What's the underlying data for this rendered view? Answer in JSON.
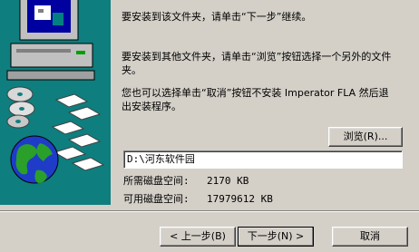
{
  "text": {
    "para1": "要安装到该文件夹，请单击“下一步”继续。",
    "para2": "要安装到其他文件夹，请单击“浏览”按钮选择一个另外的文件夹。",
    "para3": "您也可以选择单击“取消”按钮不安装 Imperator FLA 然后退出安装程序。"
  },
  "browse": {
    "label": "浏览(R)..."
  },
  "path": {
    "value": "D:\\河东软件园"
  },
  "space": {
    "required_label": "所需磁盘空间:",
    "required_value": "2170 KB",
    "available_label": "可用磁盘空间:",
    "available_value": "17979612 KB"
  },
  "buttons": {
    "back": "< 上一步(B)",
    "next": "下一步(N) >",
    "cancel": "取消"
  },
  "colors": {
    "art_background": "#0f7e7e",
    "dialog_background": "#d4d0c8"
  },
  "icons": [
    "computer-icon",
    "cd-disc-icon",
    "floppy-disk-icon",
    "globe-icon"
  ]
}
